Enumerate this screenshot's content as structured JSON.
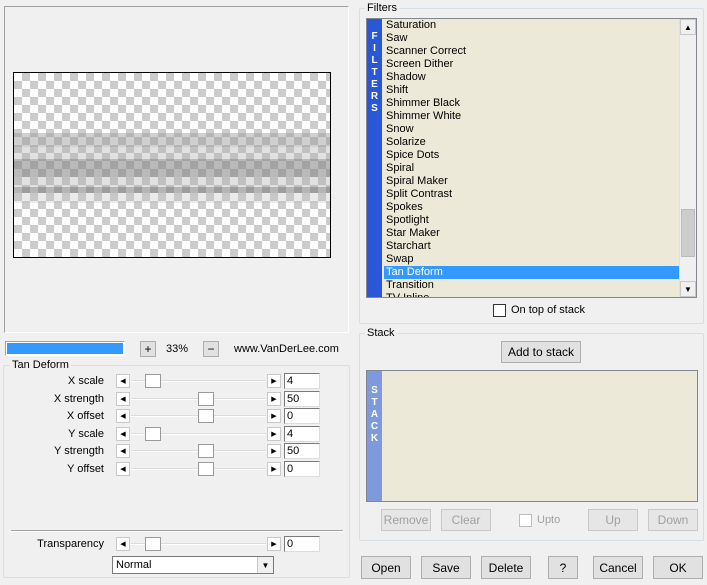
{
  "filters_panel": {
    "title": "Filters",
    "vertical_label": [
      "F",
      "I",
      "L",
      "T",
      "E",
      "R",
      "S"
    ],
    "items": [
      "Saturation",
      "Saw",
      "Scanner Correct",
      "Screen Dither",
      "Shadow",
      "Shift",
      "Shimmer Black",
      "Shimmer White",
      "Snow",
      "Solarize",
      "Spice Dots",
      "Spiral",
      "Spiral Maker",
      "Split Contrast",
      "Spokes",
      "Spotlight",
      "Star Maker",
      "Starchart",
      "Swap",
      "Tan Deform",
      "Transition",
      "TV Inline"
    ],
    "selected": "Tan Deform",
    "on_top_label": "On top of stack"
  },
  "stack_panel": {
    "title": "Stack",
    "add_label": "Add to stack",
    "vertical_label": [
      "S",
      "T",
      "A",
      "C",
      "K"
    ],
    "remove_label": "Remove",
    "clear_label": "Clear",
    "upto_label": "Upto",
    "up_label": "Up",
    "down_label": "Down"
  },
  "zoom": {
    "plus": "+",
    "minus": "−",
    "value": "33%",
    "site": "www.VanDerLee.com"
  },
  "params": {
    "group_title": "Tan Deform",
    "rows": [
      {
        "label": "X scale",
        "value": "4",
        "level": 0.12
      },
      {
        "label": "X strength",
        "value": "50",
        "level": 0.56
      },
      {
        "label": "X offset",
        "value": "0",
        "level": 0.56
      },
      {
        "label": "Y scale",
        "value": "4",
        "level": 0.12
      },
      {
        "label": "Y strength",
        "value": "50",
        "level": 0.56
      },
      {
        "label": "Y offset",
        "value": "0",
        "level": 0.56
      }
    ],
    "transparency_label": "Transparency",
    "transparency_value": "0",
    "transparency_level": 0.12,
    "blend_mode": "Normal"
  },
  "footer": {
    "open": "Open",
    "save": "Save",
    "delete": "Delete",
    "help": "?",
    "cancel": "Cancel",
    "ok": "OK"
  },
  "colors": {
    "accent": "#3399ff",
    "filters_bar": "#2a57d8",
    "stack_bar": "#7f9adb",
    "list_bg": "#ece9d8"
  }
}
